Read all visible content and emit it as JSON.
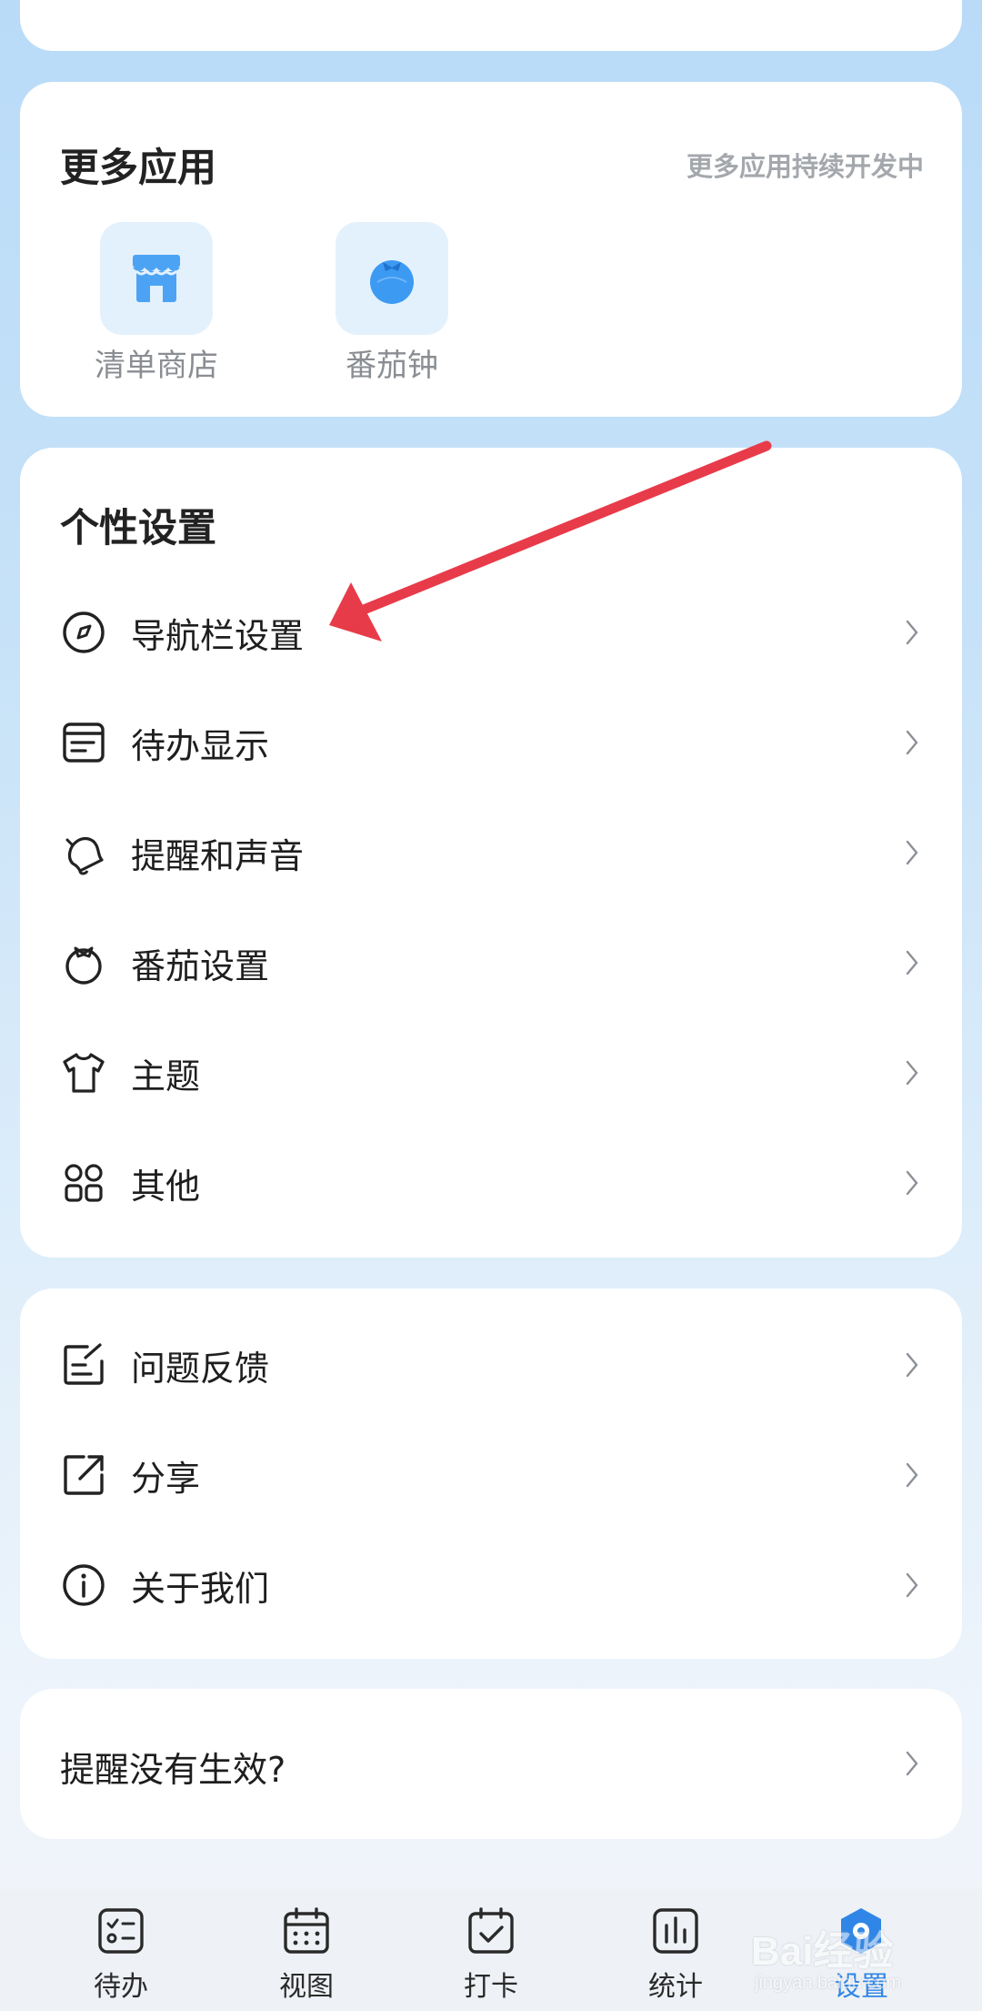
{
  "more_apps": {
    "title": "更多应用",
    "subtitle": "更多应用持续开发中",
    "apps": [
      {
        "label": "清单商店",
        "icon": "store-icon"
      },
      {
        "label": "番茄钟",
        "icon": "tomato-icon"
      }
    ]
  },
  "personal_settings": {
    "title": "个性设置",
    "items": [
      {
        "label": "导航栏设置",
        "icon": "compass-icon"
      },
      {
        "label": "待办显示",
        "icon": "todo-card-icon"
      },
      {
        "label": "提醒和声音",
        "icon": "bell-icon"
      },
      {
        "label": "番茄设置",
        "icon": "tomato-outline-icon"
      },
      {
        "label": "主题",
        "icon": "shirt-icon"
      },
      {
        "label": "其他",
        "icon": "grid-icon"
      }
    ]
  },
  "misc": {
    "items": [
      {
        "label": "问题反馈",
        "icon": "feedback-icon"
      },
      {
        "label": "分享",
        "icon": "share-icon"
      },
      {
        "label": "关于我们",
        "icon": "info-icon"
      }
    ]
  },
  "reminder_help": {
    "label": "提醒没有生效?"
  },
  "tabbar": {
    "active": "设置",
    "tabs": [
      {
        "label": "待办",
        "icon": "todo-list-icon"
      },
      {
        "label": "视图",
        "icon": "calendar-icon"
      },
      {
        "label": "打卡",
        "icon": "check-calendar-icon"
      },
      {
        "label": "统计",
        "icon": "stats-icon"
      },
      {
        "label": "设置",
        "icon": "settings-hex-icon"
      }
    ]
  },
  "watermark": {
    "brand": "Bai经验",
    "sub": "jingyan.baidu.com"
  },
  "colors": {
    "accent": "#2f86e6",
    "app_tile_bg": "#e3f1fd",
    "annotation_arrow": "#e83b4a"
  }
}
